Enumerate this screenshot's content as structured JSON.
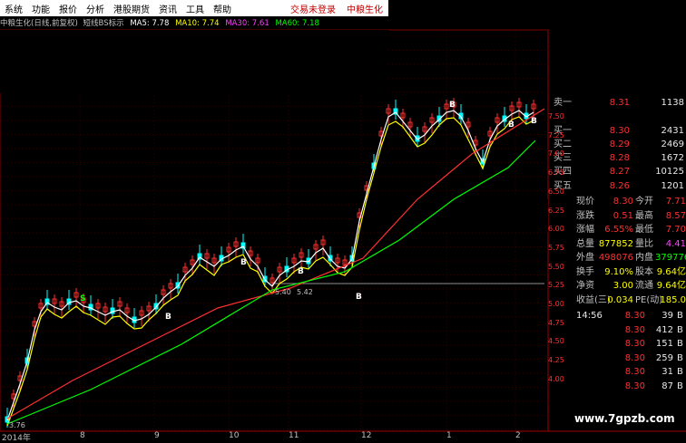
{
  "menu": {
    "items": [
      "系统",
      "功能",
      "报价",
      "分析",
      "港股期货",
      "资讯",
      "工具",
      "帮助"
    ],
    "trade_login": "交易未登录",
    "stock_name": "中粮生化"
  },
  "indicator_bar": {
    "title": "中粮生化(日线,前复权)",
    "indicator": "短线BS标示",
    "ma5": "MA5: 7.78",
    "ma10": "MA10: 7.74",
    "ma30": "MA30: 7.61",
    "ma60": "MA60: 7.18",
    "colors": {
      "title": "#c0c0c0",
      "ma5": "#ffffff",
      "ma10": "#ffff00",
      "ma30": "#ff3fff",
      "ma60": "#00ff00"
    }
  },
  "quotes": [
    {
      "label": "卖一",
      "price": "8.31",
      "vol": "1138"
    },
    {
      "label": "买一",
      "price": "8.30",
      "vol": "2431"
    },
    {
      "label": "买二",
      "price": "8.29",
      "vol": "2469"
    },
    {
      "label": "买三",
      "price": "8.28",
      "vol": "1672"
    },
    {
      "label": "买四",
      "price": "8.27",
      "vol": "10125"
    },
    {
      "label": "买五",
      "price": "8.26",
      "vol": "1201"
    }
  ],
  "stats": [
    {
      "l1": "现价",
      "v1": "8.30",
      "c1": "#ff3030",
      "l2": "今开",
      "v2": "7.71",
      "c2": "#ff3030"
    },
    {
      "l1": "涨跌",
      "v1": "0.51",
      "c1": "#ff3030",
      "l2": "最高",
      "v2": "8.57",
      "c2": "#ff3030"
    },
    {
      "l1": "涨幅",
      "v1": "6.55%",
      "c1": "#ff3030",
      "l2": "最低",
      "v2": "7.70",
      "c2": "#ff3030"
    },
    {
      "l1": "总量",
      "v1": "877852",
      "c1": "#ffff00",
      "l2": "量比",
      "v2": "4.41",
      "c2": "#ff3fff"
    },
    {
      "l1": "外盘",
      "v1": "498076",
      "c1": "#ff3030",
      "l2": "内盘",
      "v2": "379776",
      "c2": "#00ff00"
    },
    {
      "l1": "换手",
      "v1": "9.10%",
      "c1": "#ffff00",
      "l2": "股本",
      "v2": "9.64亿",
      "c2": "#ffff00"
    },
    {
      "l1": "净资",
      "v1": "3.00",
      "c1": "#ffff00",
      "l2": "流通",
      "v2": "9.64亿",
      "c2": "#ffff00"
    },
    {
      "l1": "收益(三)",
      "v1": "0.034",
      "c1": "#ffff00",
      "l2": "PE(动)",
      "v2": "185.0",
      "c2": "#ffff00"
    }
  ],
  "ticks": [
    {
      "time": "14:56",
      "price": "8.30",
      "vol": "39",
      "dir": "B"
    },
    {
      "time": "",
      "price": "8.30",
      "vol": "412",
      "dir": "B"
    },
    {
      "time": "",
      "price": "8.30",
      "vol": "151",
      "dir": "B"
    },
    {
      "time": "",
      "price": "8.30",
      "vol": "259",
      "dir": "B"
    },
    {
      "time": "",
      "price": "8.30",
      "vol": "31",
      "dir": "B"
    },
    {
      "time": "",
      "price": "8.30",
      "vol": "87",
      "dir": "B"
    }
  ],
  "price_axis": [
    "7.50",
    "7.25",
    "7.00",
    "6.75",
    "6.50",
    "6.25",
    "6.00",
    "5.75",
    "5.50",
    "5.25",
    "5.00",
    "4.75",
    "4.50",
    "4.25",
    "4.00"
  ],
  "x_axis": [
    "2014年",
    "8",
    "9",
    "10",
    "11",
    "12",
    "1",
    "2"
  ],
  "annotations": {
    "low_label": "5.40",
    "low_label2": "5.42",
    "start_label": "3.76",
    "s_mark": "S",
    "b_mark": "B"
  },
  "watermark": "www.7gpzb.com"
}
